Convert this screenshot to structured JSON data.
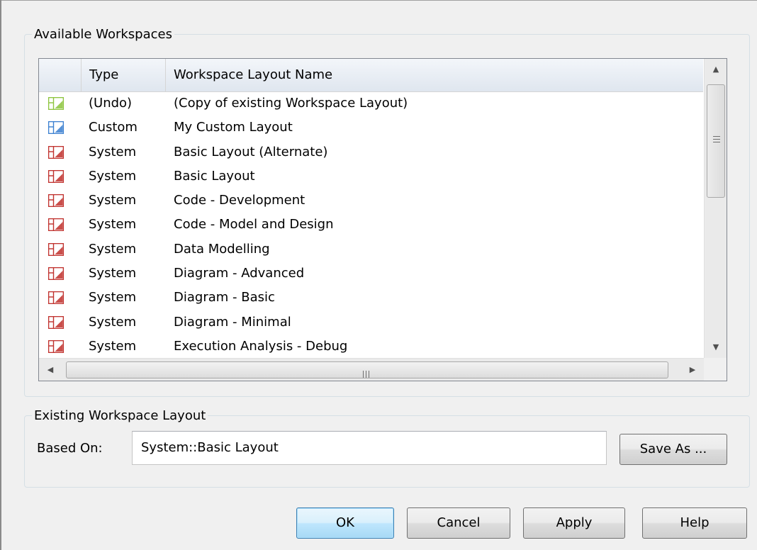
{
  "workspaces": {
    "legend": "Available Workspaces",
    "columns": [
      "",
      "Type",
      "Workspace Layout Name"
    ],
    "rows": [
      {
        "icon": "workspace-green-icon",
        "type": "(Undo)",
        "name": "(Copy of existing Workspace Layout)"
      },
      {
        "icon": "workspace-blue-icon",
        "type": "Custom",
        "name": "My Custom Layout"
      },
      {
        "icon": "workspace-red-icon",
        "type": "System",
        "name": "Basic Layout (Alternate)"
      },
      {
        "icon": "workspace-red-icon",
        "type": "System",
        "name": "Basic Layout"
      },
      {
        "icon": "workspace-red-icon",
        "type": "System",
        "name": "Code - Development"
      },
      {
        "icon": "workspace-red-icon",
        "type": "System",
        "name": "Code - Model and Design"
      },
      {
        "icon": "workspace-red-icon",
        "type": "System",
        "name": "Data Modelling"
      },
      {
        "icon": "workspace-red-icon",
        "type": "System",
        "name": "Diagram - Advanced"
      },
      {
        "icon": "workspace-red-icon",
        "type": "System",
        "name": "Diagram - Basic"
      },
      {
        "icon": "workspace-red-icon",
        "type": "System",
        "name": "Diagram - Minimal"
      },
      {
        "icon": "workspace-red-icon",
        "type": "System",
        "name": "Execution Analysis - Debug"
      }
    ]
  },
  "existing": {
    "legend": "Existing Workspace Layout",
    "based_on_label": "Based On:",
    "based_on_value": "System::Basic Layout",
    "save_as_label": "Save As ..."
  },
  "buttons": {
    "ok": "OK",
    "cancel": "Cancel",
    "apply": "Apply",
    "help": "Help"
  },
  "icon_colors": {
    "green": "#8cc43c",
    "blue": "#3a7fd0",
    "red": "#c0302c"
  }
}
